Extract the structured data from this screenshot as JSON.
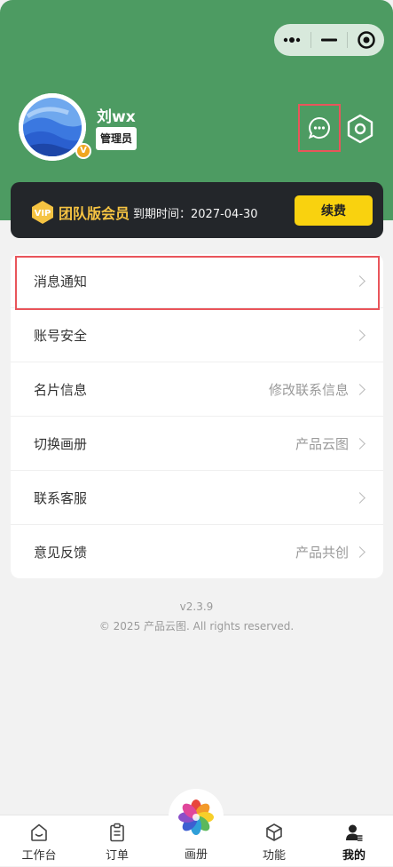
{
  "profile": {
    "name": "刘wx",
    "role": "管理员",
    "badge": "V"
  },
  "vip": {
    "icon_text": "VIP",
    "title": "团队版会员",
    "expire": "到期时间：2027-04-30",
    "renew_label": "续费"
  },
  "menu": {
    "items": [
      {
        "label": "消息通知",
        "value": ""
      },
      {
        "label": "账号安全",
        "value": ""
      },
      {
        "label": "名片信息",
        "value": "修改联系信息"
      },
      {
        "label": "切换画册",
        "value": "产品云图"
      },
      {
        "label": "联系客服",
        "value": ""
      },
      {
        "label": "意见反馈",
        "value": "产品共创"
      }
    ]
  },
  "footer": {
    "version": "v2.3.9",
    "copyright": "© 2025 产品云图. All rights reserved."
  },
  "tabbar": {
    "tabs": [
      {
        "label": "工作台",
        "icon": "workbench-icon"
      },
      {
        "label": "订单",
        "icon": "order-icon"
      },
      {
        "label": "画册",
        "icon": "album-icon"
      },
      {
        "label": "功能",
        "icon": "cube-icon"
      },
      {
        "label": "我的",
        "icon": "user-icon"
      }
    ]
  },
  "colors": {
    "header_green": "#4d9b62",
    "vip_gold": "#f5c342",
    "renew_yellow": "#f9d20f",
    "highlight_red": "#e9555b"
  }
}
